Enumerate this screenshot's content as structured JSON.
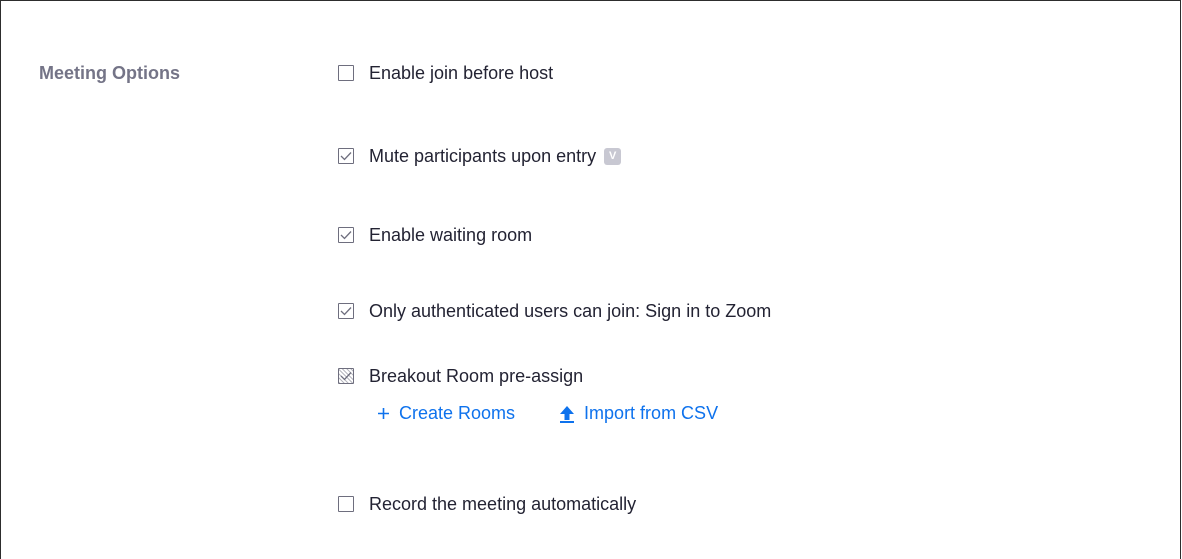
{
  "section": {
    "label": "Meeting Options"
  },
  "options": [
    {
      "label": "Enable join before host",
      "checked": false
    },
    {
      "label": "Mute participants upon entry",
      "checked": true,
      "badge": "V"
    },
    {
      "label": "Enable waiting room",
      "checked": true
    },
    {
      "label": "Only authenticated users can join: Sign in to Zoom",
      "checked": true
    },
    {
      "label": "Breakout Room pre-assign",
      "checked": "indeterminate"
    },
    {
      "label": "Record the meeting automatically",
      "checked": false
    }
  ],
  "breakout_actions": {
    "create_rooms": {
      "icon": "plus-icon",
      "label": "Create Rooms"
    },
    "import_csv": {
      "icon": "upload-arrow-icon",
      "label": "Import from CSV"
    }
  },
  "colors": {
    "link": "#0e72ed",
    "section_label": "#747487",
    "text": "#232333"
  }
}
